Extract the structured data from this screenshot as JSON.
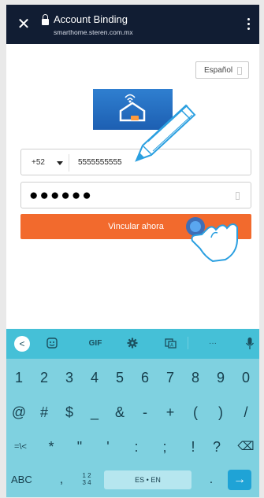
{
  "header": {
    "title": "Account Binding",
    "url": "smarthome.steren.com.mx",
    "close_icon": "close-icon",
    "menu_icon": "more-vertical-icon"
  },
  "language": {
    "label": "Español"
  },
  "form": {
    "country_code": "+52",
    "phone": "5555555555",
    "password_mask": "●●●●●●",
    "submit_label": "Vincular ahora"
  },
  "keyboard": {
    "toolbar": {
      "back": "<",
      "gif": "GIF",
      "more": "···"
    },
    "row_numbers": [
      "1",
      "2",
      "3",
      "4",
      "5",
      "6",
      "7",
      "8",
      "9",
      "0"
    ],
    "row_symbols1": [
      "@",
      "#",
      "$",
      "_",
      "&",
      "-",
      "+",
      "(",
      ")",
      "/"
    ],
    "row_symbols2": [
      "=\\<",
      "*",
      "\"",
      "'",
      ":",
      ";",
      "!",
      "?",
      "⌫"
    ],
    "bottom": {
      "abc": "ABC",
      "comma": ",",
      "numpad_top": "1 2",
      "numpad_bottom": "3 4",
      "space": "ES • EN",
      "period": ".",
      "enter": "→"
    }
  },
  "colors": {
    "topbar": "#111d33",
    "accent_orange": "#f26a2d",
    "keyboard_bg": "#7fd1e0",
    "keyboard_toolbar": "#45c0d7"
  }
}
